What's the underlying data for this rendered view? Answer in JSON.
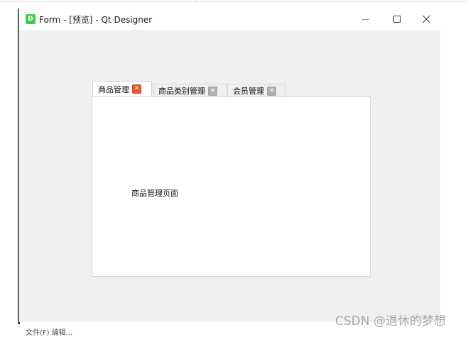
{
  "window": {
    "title": "Form - [预览] - Qt Designer",
    "app_icon": {
      "name": "qt-designer-icon",
      "letter": "D",
      "color": "#41cd52"
    },
    "controls": {
      "minimize_icon": "minimize-icon",
      "maximize_icon": "maximize-icon",
      "close_icon": "close-icon"
    }
  },
  "tabs": [
    {
      "label": "商品管理",
      "active": true,
      "close_glyph": "✕"
    },
    {
      "label": "商品类别管理",
      "active": false,
      "close_glyph": "✕"
    },
    {
      "label": "会员管理",
      "active": false,
      "close_glyph": "✕"
    }
  ],
  "panel": {
    "content_label": "商品管理页面"
  },
  "background_text": "文件(F) 编辑...",
  "watermark": "CSDN @退休的梦想",
  "colors": {
    "window_bg": "#f0f0f0",
    "panel_bg": "#ffffff",
    "active_close": "#e0593a",
    "inactive_close": "#b0b0b0"
  }
}
